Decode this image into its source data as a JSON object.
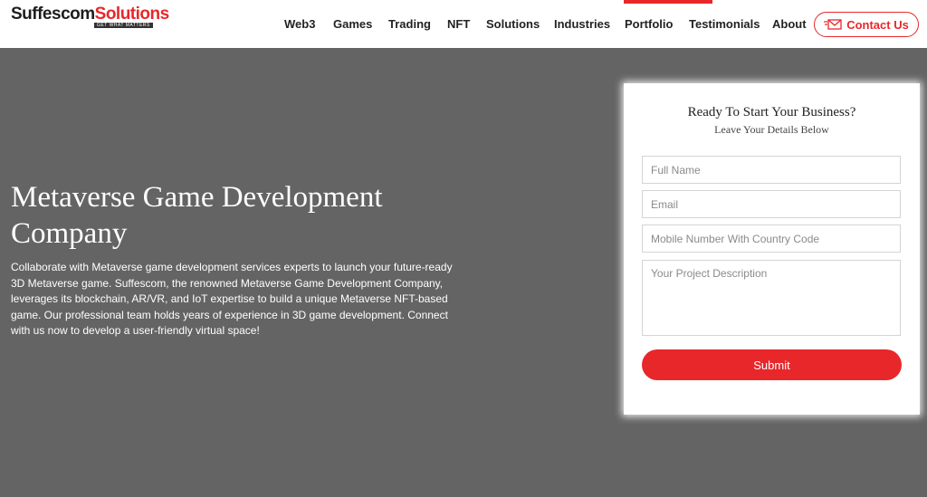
{
  "header": {
    "logo": {
      "part1": "Suffescom",
      "part2": "Solutions",
      "tagline": "GET WHAT MATTERS"
    },
    "nav": [
      "Web3",
      "Games",
      "Trading",
      "NFT",
      "Solutions",
      "Industries",
      "Portfolio",
      "Testimonials",
      "About"
    ],
    "contact_label": "Contact Us",
    "accent_color": "#e8272b"
  },
  "hero": {
    "title": "Metaverse Game Development Company",
    "description": "Collaborate with Metaverse game development services experts to launch your future-ready 3D Metaverse game. Suffescom, the renowned Metaverse Game Development Company, leverages its blockchain, AR/VR, and IoT expertise to build a unique Metaverse NFT-based game. Our professional team holds years of experience in 3D game development. Connect with us now to develop a user-friendly virtual space!"
  },
  "form": {
    "title": "Ready To Start Your Business?",
    "subtitle": "Leave Your Details Below",
    "fields": {
      "name": {
        "placeholder": "Full Name",
        "value": ""
      },
      "email": {
        "placeholder": "Email",
        "value": ""
      },
      "mobile": {
        "placeholder": "Mobile Number With Country Code",
        "value": ""
      },
      "description": {
        "placeholder": "Your Project Description",
        "value": ""
      }
    },
    "submit_label": "Submit"
  },
  "icons": {
    "contact": "envelope-icon"
  }
}
